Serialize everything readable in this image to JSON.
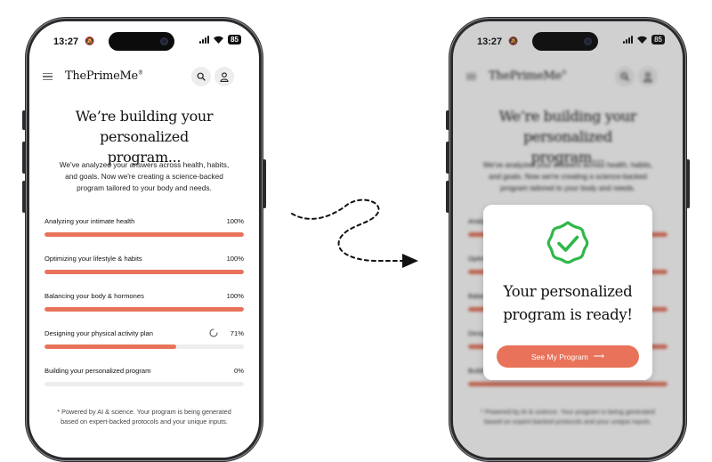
{
  "status": {
    "time": "13:27",
    "battery": "85"
  },
  "brand": {
    "name": "ThePrimeMe",
    "mark": "®"
  },
  "headline": {
    "line1": "We’re building your personalized",
    "line2": "program..."
  },
  "intro": {
    "line1": "We've analyzed your answers across health, habits,",
    "line2": "and goals. Now we're creating a science-backed",
    "line3": "program tailored to your body and needs."
  },
  "steps": [
    {
      "label": "Analyzing your intimate health",
      "percent": "100%",
      "progress": 1.0
    },
    {
      "label": "Optimizing your lifestyle & habits",
      "percent": "100%",
      "progress": 1.0
    },
    {
      "label": "Balancing your body & hormones",
      "percent": "100%",
      "progress": 1.0
    },
    {
      "label": "Designing your physical activity plan",
      "percent": "71%",
      "progress": 0.66,
      "loading": true
    },
    {
      "label": "Building your personalized program",
      "percent": "0%",
      "progress": 0.0
    }
  ],
  "footnote": {
    "line1": "* Powered by AI & science. Your program is being generated",
    "line2": "based on expert-backed protocols and your unique inputs."
  },
  "modal": {
    "line1": "Your personalized",
    "line2": "program is ready!",
    "cta": "See My Program",
    "cta_arrow": "⟶",
    "check_color": "#2fb84a"
  },
  "colors": {
    "accent": "#e8735a",
    "track": "#eeeeee"
  },
  "icons": {
    "menu": "menu-icon",
    "search": "search-icon",
    "user": "user-icon",
    "check": "check-badge-icon",
    "arrow": "arrow-right-icon",
    "spinner": "loading-spinner-icon"
  }
}
